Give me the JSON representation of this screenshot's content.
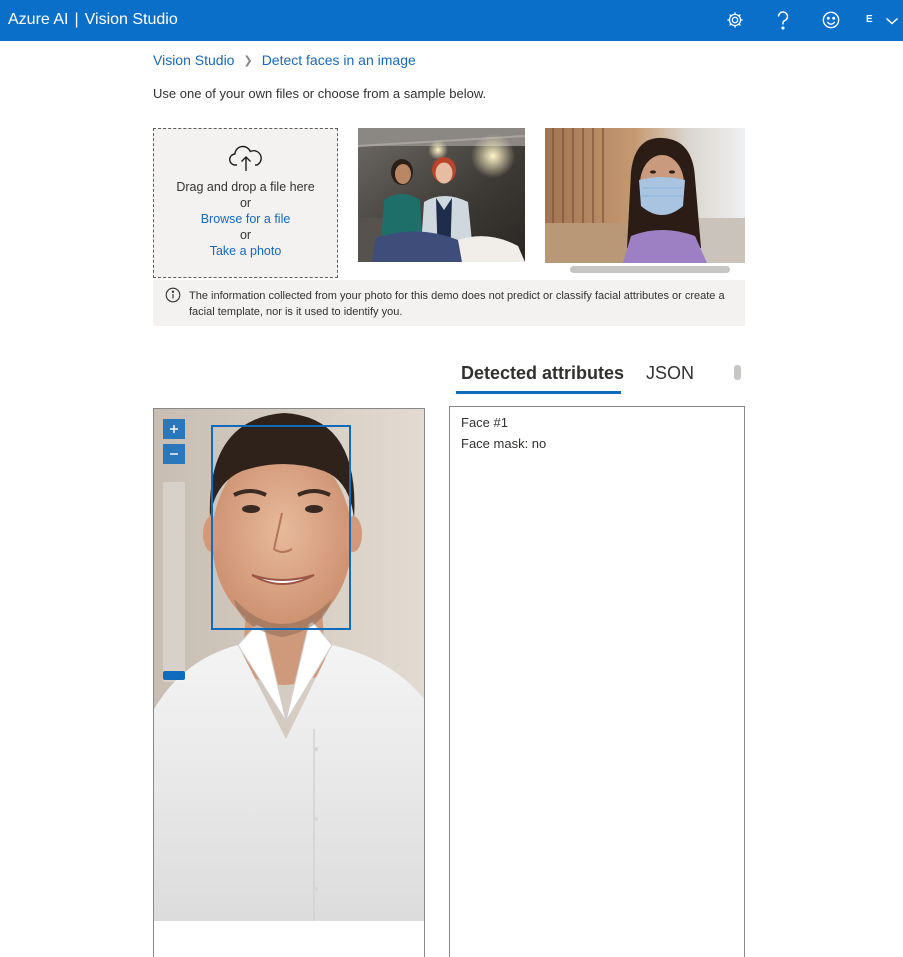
{
  "header": {
    "brand": "Azure AI",
    "separator": "|",
    "app_name": "Vision Studio",
    "account_initial": "E",
    "accent_color": "#0a6fc9"
  },
  "breadcrumb": {
    "root": "Vision Studio",
    "current": "Detect faces in an image"
  },
  "intro_text": "Use one of your own files or choose from a sample below.",
  "upload": {
    "drag_text": "Drag and drop a file here",
    "or_1": "or",
    "browse_link": "Browse for a file",
    "or_2": "or",
    "photo_link": "Take a photo"
  },
  "notice": {
    "text": "The information collected from your photo for this demo does not predict or classify facial attributes or create a facial template, nor is it used to identify you."
  },
  "tabs": [
    {
      "label": "Detected attributes",
      "active": true
    },
    {
      "label": "JSON",
      "active": false
    }
  ],
  "results": {
    "face_label": "Face #1",
    "mask_label": "Face mask: no"
  },
  "icons": {
    "settings": "gear-icon",
    "help": "help-icon",
    "feedback": "smiley-icon",
    "account_menu": "chevron-down-icon",
    "upload": "cloud-upload-icon",
    "info": "info-icon",
    "zoom_in": "zoom-in-icon",
    "zoom_out": "zoom-out-icon"
  }
}
